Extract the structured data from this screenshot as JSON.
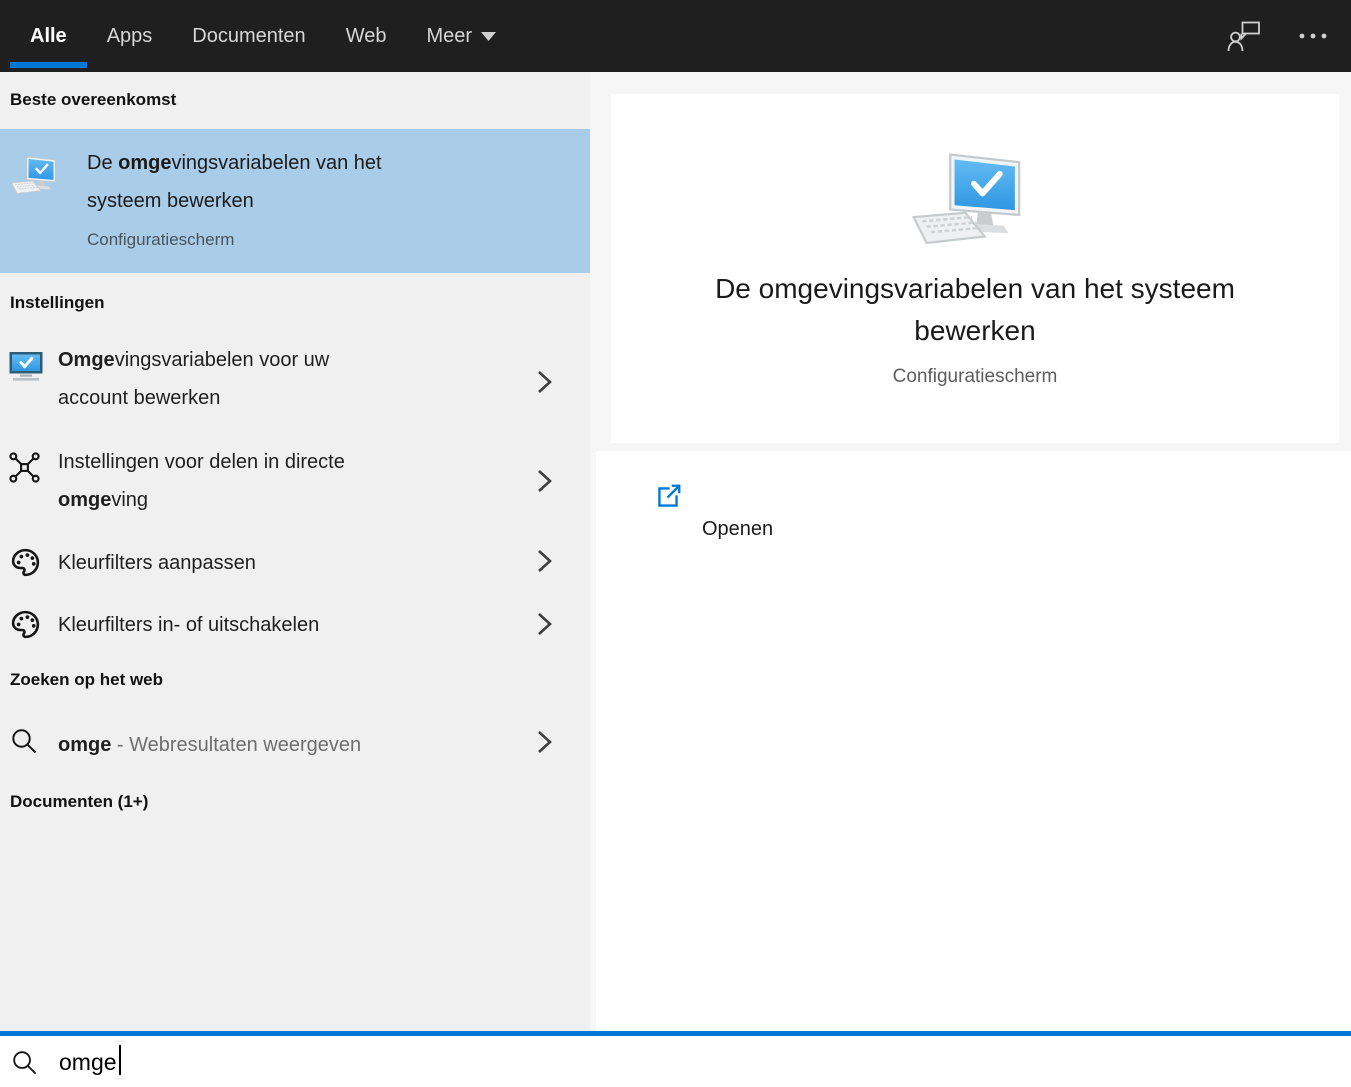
{
  "topbar": {
    "tabs": [
      {
        "label": "Alle",
        "active": true
      },
      {
        "label": "Apps",
        "active": false
      },
      {
        "label": "Documenten",
        "active": false
      },
      {
        "label": "Web",
        "active": false
      },
      {
        "label": "Meer",
        "active": false,
        "dropdown": true
      }
    ]
  },
  "sections": {
    "best_match_header": "Beste overeenkomst",
    "settings_header": "Instellingen",
    "web_header": "Zoeken op het web",
    "documents_header": "Documenten (1+)"
  },
  "best_match": {
    "title_lines": [
      [
        {
          "t": "De ",
          "b": 0
        },
        {
          "t": "omge",
          "b": 1
        },
        {
          "t": "vingsvariabelen van het",
          "b": 0
        }
      ],
      [
        {
          "t": "systeem bewerken",
          "b": 0
        }
      ]
    ],
    "subtitle": "Configuratiescherm"
  },
  "settings_items": [
    {
      "lines": [
        [
          {
            "t": "Omge",
            "b": 1
          },
          {
            "t": "vingsvariabelen voor uw",
            "b": 0
          }
        ],
        [
          {
            "t": "account bewerken",
            "b": 0
          }
        ]
      ]
    },
    {
      "lines": [
        [
          {
            "t": "Instellingen voor delen in directe",
            "b": 0
          }
        ],
        [
          {
            "t": "omge",
            "b": 1
          },
          {
            "t": "ving",
            "b": 0
          }
        ]
      ]
    },
    {
      "lines": [
        [
          {
            "t": "Kleurfilters aanpassen",
            "b": 0
          }
        ]
      ]
    },
    {
      "lines": [
        [
          {
            "t": "Kleurfilters in- of uitschakelen",
            "b": 0
          }
        ]
      ]
    }
  ],
  "web_item": {
    "lines": [
      [
        {
          "t": "omge",
          "b": 1
        },
        {
          "t": " - Webresultaten weergeven",
          "b": 0,
          "m": 1
        }
      ]
    ]
  },
  "preview": {
    "title_line1": "De omgevingsvariabelen van het systeem",
    "title_line2": "bewerken",
    "subtitle": "Configuratiescherm",
    "action_label": "Openen"
  },
  "search_bar": {
    "value": "omge"
  },
  "icons": {
    "best_match": "computer-check-icon",
    "preview": "computer-check-icon",
    "settings_item_1": "monitor-check-icon",
    "settings_item_2": "nearby-share-icon",
    "settings_item_3": "color-palette-icon",
    "settings_item_4": "color-palette-icon",
    "web_item": "search-icon",
    "row_arrow": "chevron-right-icon",
    "action": "open-external-icon",
    "topbar_right_1": "feedback-chat-icon",
    "topbar_right_2": "more-options-icon",
    "search_bar": "search-icon",
    "meer_tab": "dropdown-triangle-icon"
  },
  "colors": {
    "accent": "#0078d7",
    "selection": "#a9cce9",
    "topbar_bg": "#1f1f1f",
    "left_panel_bg": "#f0f0f0",
    "right_bg": "#f6f6f6",
    "muted_text": "#6e6e6e"
  }
}
